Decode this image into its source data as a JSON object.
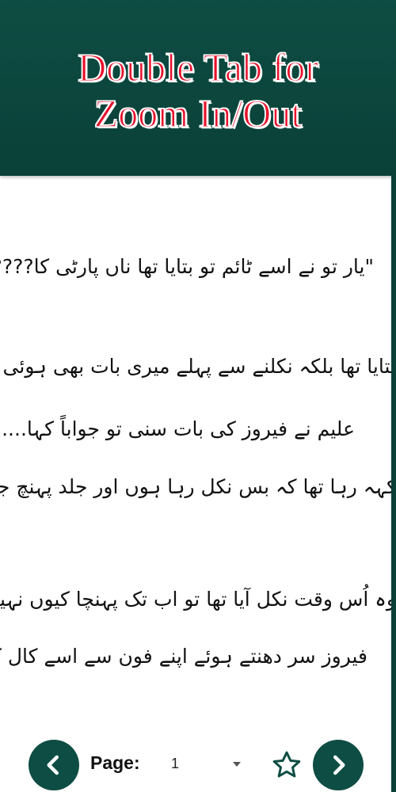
{
  "banner": {
    "line1": "Double Tab for",
    "line2": "Zoom In/Out"
  },
  "content": {
    "lines": [
      "\"یار تو نے اسے ٹائم تو بتایا تھا ناں پارٹی کا????\"",
      "بتایا تھا بلکہ نکلنے سے پہلے میری بات بھی ہوئی تھی اس سے",
      "علیم نے فیروز کی بات سنی تو جواباً کہا....",
      "کہہ رہا تھا کہ بس نکل رہا ہوں اور جلد پہنچ جاؤں گا\" !!!!",
      "وہ اُس وقت نکل آیا تھا تو اب تک پہنچا کیوں نہیں????\"",
      "فیروز سر دھنتے ہوئے اپنے فون سے اسے کال کرنے لگا....."
    ]
  },
  "nav": {
    "page_label": "Page:",
    "page_value": "1"
  },
  "colors": {
    "primary": "#0e4d43",
    "title_red": "#e8102a"
  },
  "icons": {
    "prev": "chevron-left-icon",
    "next": "chevron-right-icon",
    "favorite": "star-outline-icon",
    "dropdown": "caret-down-icon"
  }
}
